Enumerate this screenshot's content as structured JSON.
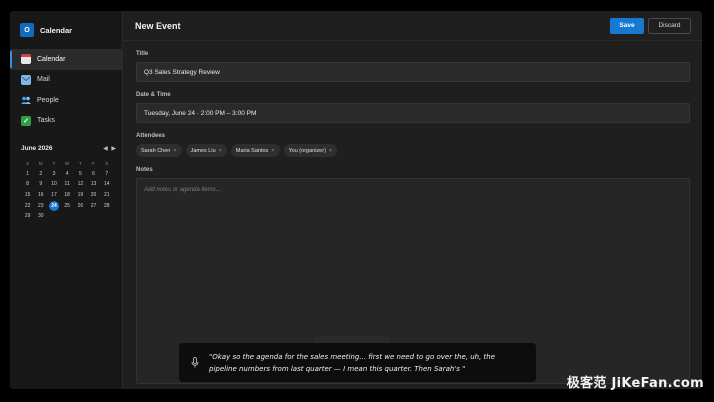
{
  "app": {
    "logo_letter": "O",
    "title": "Calendar"
  },
  "sidebar": {
    "items": [
      {
        "label": "Calendar",
        "icon": "calendar-icon",
        "active": true
      },
      {
        "label": "Mail",
        "icon": "mail-icon",
        "active": false
      },
      {
        "label": "People",
        "icon": "people-icon",
        "active": false
      },
      {
        "label": "Tasks",
        "icon": "tasks-icon",
        "active": false
      }
    ]
  },
  "mini_calendar": {
    "title": "June 2026",
    "prev": "◀",
    "next": "▶",
    "weekdays": [
      "S",
      "M",
      "T",
      "W",
      "T",
      "F",
      "S"
    ],
    "days": [
      [
        "1",
        "2",
        "3",
        "4",
        "5",
        "6",
        "7"
      ],
      [
        "8",
        "9",
        "10",
        "11",
        "12",
        "13",
        "14"
      ],
      [
        "15",
        "16",
        "17",
        "18",
        "19",
        "20",
        "21"
      ],
      [
        "22",
        "23",
        "24",
        "25",
        "26",
        "27",
        "28"
      ],
      [
        "29",
        "30",
        "",
        "",
        "",
        "",
        ""
      ]
    ],
    "today": "24"
  },
  "header": {
    "title": "New Event",
    "save_label": "Save",
    "discard_label": "Discard"
  },
  "form": {
    "title_label": "Title",
    "title_value": "Q3 Sales Strategy Review",
    "datetime_label": "Date & Time",
    "datetime_value": "Tuesday, June 24 · 2:00 PM – 3:00 PM",
    "attendees_label": "Attendees",
    "attendees": [
      {
        "name": "Sarah Chen",
        "remove": "×"
      },
      {
        "name": "James Liu",
        "remove": "×"
      },
      {
        "name": "Maria Santos",
        "remove": "×"
      },
      {
        "name": "You (organizer)",
        "remove": "×"
      }
    ],
    "notes_label": "Notes",
    "notes_placeholder": "Add notes or agenda items..."
  },
  "caption": {
    "text": "\"Okay so the agenda for the sales meeting... first we need to go over the, uh, the pipeline numbers from last quarter — I mean this quarter. Then Sarah's \""
  },
  "watermark": "极客范 JiKeFan.com",
  "colors": {
    "accent": "#1778d2",
    "background": "#1f1f1f",
    "sidebar": "#181818"
  }
}
